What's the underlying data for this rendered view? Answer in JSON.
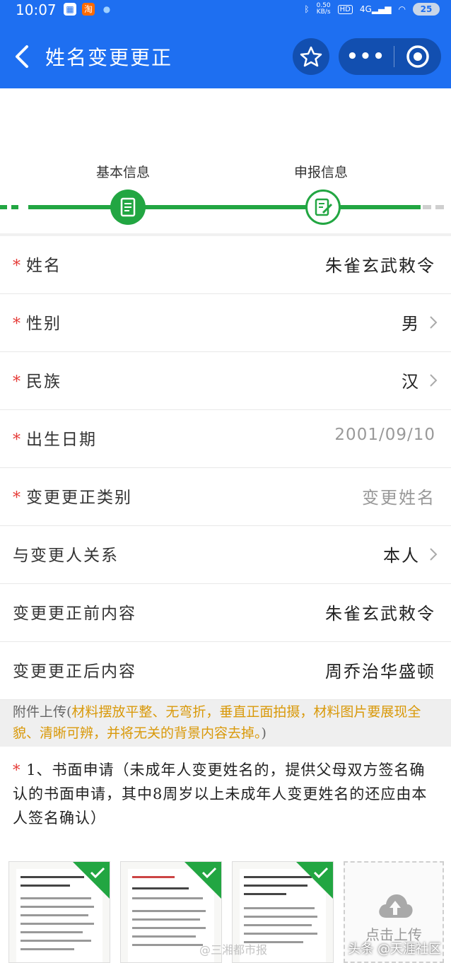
{
  "status_bar": {
    "time": "10:07",
    "network_speed_value": "0.50",
    "network_speed_unit": "KB/s",
    "hd": "HD",
    "signal": "4G",
    "battery": "25",
    "app_icon_taobao": "淘"
  },
  "header": {
    "title": "姓名变更更正",
    "more_label": "•••"
  },
  "steps": [
    {
      "label": "基本信息"
    },
    {
      "label": "申报信息"
    }
  ],
  "form": {
    "required_mark": "*",
    "rows": [
      {
        "label": "姓名",
        "value": "朱雀玄武敕令"
      },
      {
        "label": "性别",
        "value": "男"
      },
      {
        "label": "民族",
        "value": "汉"
      },
      {
        "label": "出生日期",
        "value": "2001/09/10"
      },
      {
        "label": "变更更正类别",
        "value": "变更姓名"
      },
      {
        "label": "与变更人关系",
        "value": "本人"
      },
      {
        "label": "变更更正前内容",
        "value": "朱雀玄武敕令"
      },
      {
        "label": "变更更正后内容",
        "value": "周乔治华盛顿"
      }
    ]
  },
  "attachment": {
    "head": "附件上传(",
    "body": "材料摆放平整、无弯折，垂直正面拍摄，材料图片要展现全貌、清晰可辨，并将无关的背景内容去掉。",
    "tail": ")"
  },
  "item1": {
    "required_mark": "*",
    "text": "1、书面申请（未成年人变更姓名的，提供父母双方签名确认的书面申请，其中8周岁以上未成年人变更姓名的还应由本人签名确认）"
  },
  "upload": {
    "label": "点击上传"
  },
  "watermark": {
    "left": "@三湘都市报",
    "right": "头条 @天涯社区"
  },
  "colors": {
    "header_blue": "#1e6ff1",
    "step_green": "#22a642",
    "required_red": "#e53935",
    "notice_orange": "#d9990a"
  }
}
